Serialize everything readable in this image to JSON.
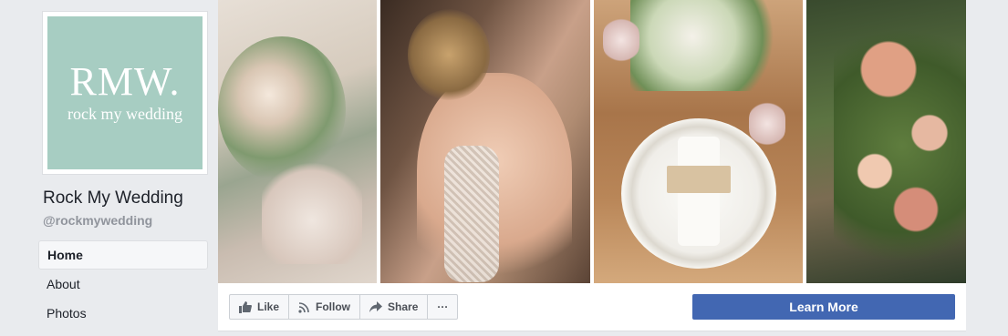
{
  "profile": {
    "logo_main": "RMW.",
    "logo_sub": "rock my wedding",
    "name": "Rock My Wedding",
    "handle": "@rockmywedding"
  },
  "nav": {
    "items": [
      {
        "label": "Home",
        "active": true
      },
      {
        "label": "About",
        "active": false
      },
      {
        "label": "Photos",
        "active": false
      }
    ]
  },
  "cover": {
    "panels": [
      {
        "icon": "bouquet-shoes-photo"
      },
      {
        "icon": "bride-back-photo"
      },
      {
        "icon": "table-setting-photo"
      },
      {
        "icon": "floral-arch-photo"
      }
    ]
  },
  "actions": {
    "like_label": "Like",
    "follow_label": "Follow",
    "share_label": "Share",
    "more_label": "···",
    "cta_label": "Learn More"
  },
  "colors": {
    "background": "#e9ebee",
    "logo_bg": "#a7cdc2",
    "cta_bg": "#4267b2"
  }
}
